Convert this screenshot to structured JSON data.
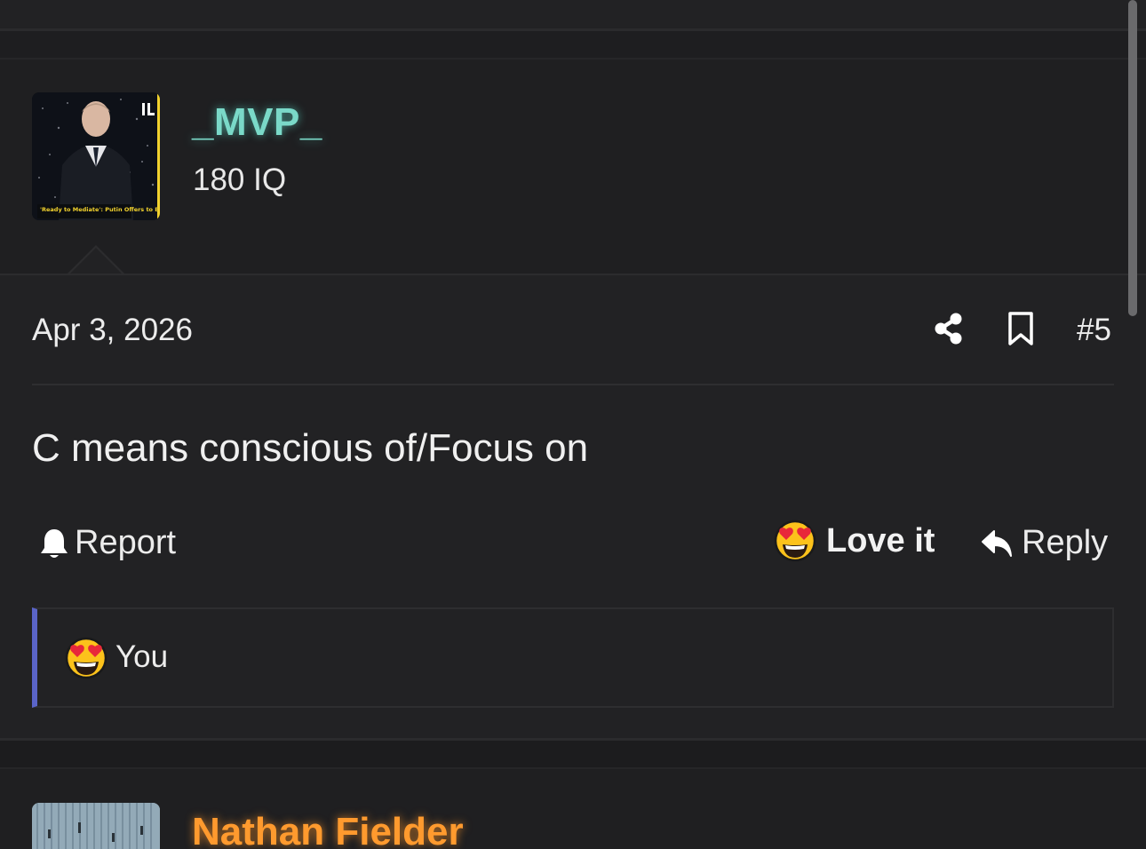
{
  "post": {
    "author": {
      "name": "_MVP_",
      "title": "180 IQ",
      "avatar_caption": "'Ready to Mediate': Putin Offers to Broker Peace B/W",
      "avatar_badge": "IL"
    },
    "date": "Apr 3, 2026",
    "number": "#5",
    "body": "C means conscious of/Focus on",
    "actions": {
      "report": "Report",
      "love": "Love it",
      "reply": "Reply"
    },
    "reactions": {
      "summary": "You"
    }
  },
  "next_post": {
    "author": {
      "name": "Nathan Fielder"
    }
  },
  "colors": {
    "background": "#1c1c1e",
    "panel": "#222224",
    "mvp_name": "#7ad9c8",
    "next_name": "#ff9a2e",
    "reaction_accent": "#5a64c8"
  },
  "icons": {
    "share": "share-icon",
    "bookmark": "bookmark-icon",
    "report": "bell-icon",
    "love": "heart-eyes-emoji-icon",
    "reply": "reply-arrow-icon"
  }
}
